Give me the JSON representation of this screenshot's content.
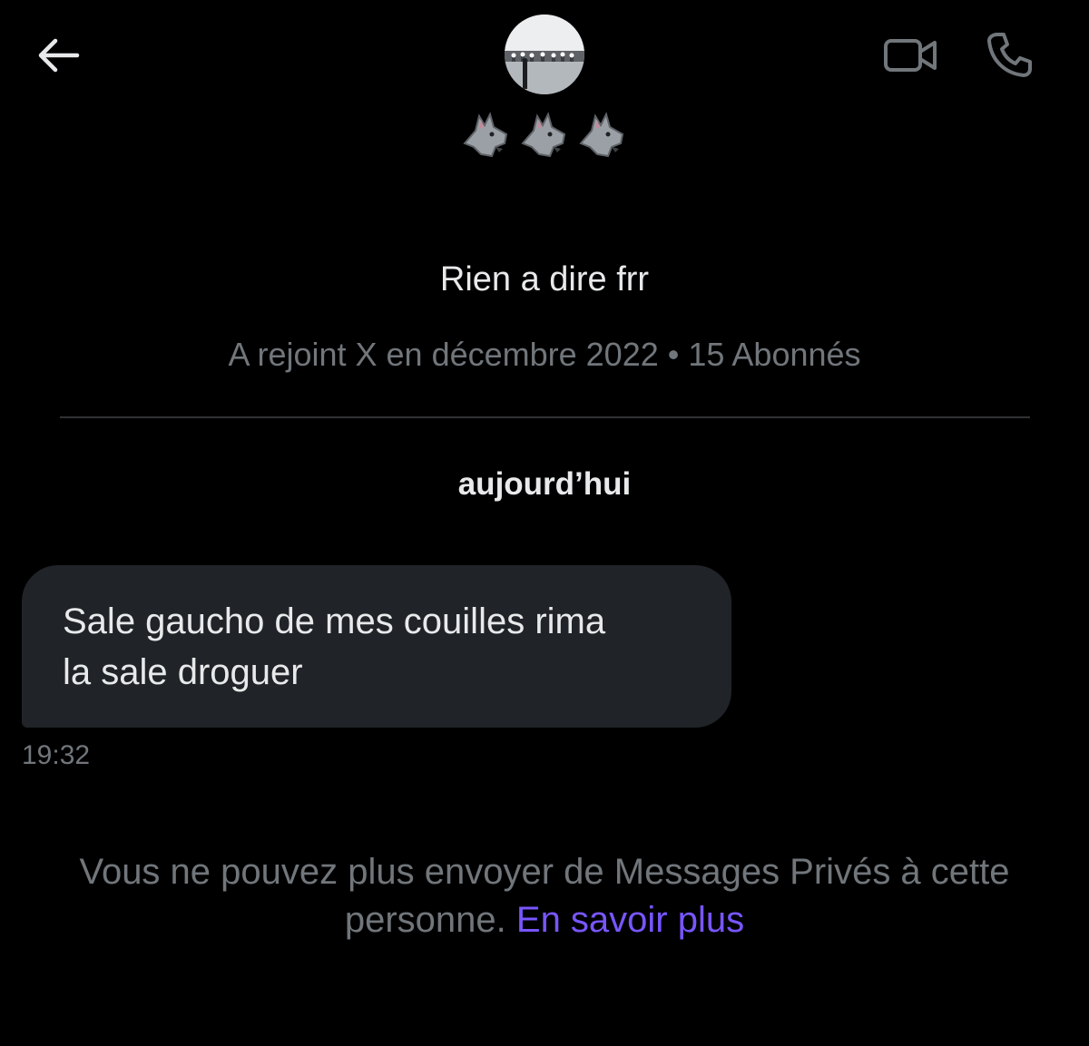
{
  "header": {
    "back_icon": "arrow-left-icon",
    "avatar_alt": "profile picture",
    "display_name_emoji": "🐺🐺🐺",
    "video_icon": "video-camera-icon",
    "call_icon": "phone-icon"
  },
  "profile": {
    "bio": "Rien a dire frr",
    "meta": "A rejoint X en décembre 2022 • 15 Abonnés"
  },
  "conversation": {
    "day_label": "aujourd’hui",
    "messages": [
      {
        "text_line1": "Sale gaucho de mes couilles rima",
        "text_line2": "la sale droguer",
        "time": "19:32"
      }
    ]
  },
  "notice": {
    "text_line1": "Vous ne pouvez plus envoyer de Messages Privés à cette",
    "text_line2": "personne. ",
    "link": "En savoir plus"
  },
  "colors": {
    "background": "#000000",
    "text_primary": "#e7e9ea",
    "text_secondary": "#71767b",
    "bubble": "#202327",
    "link": "#7856ff"
  }
}
